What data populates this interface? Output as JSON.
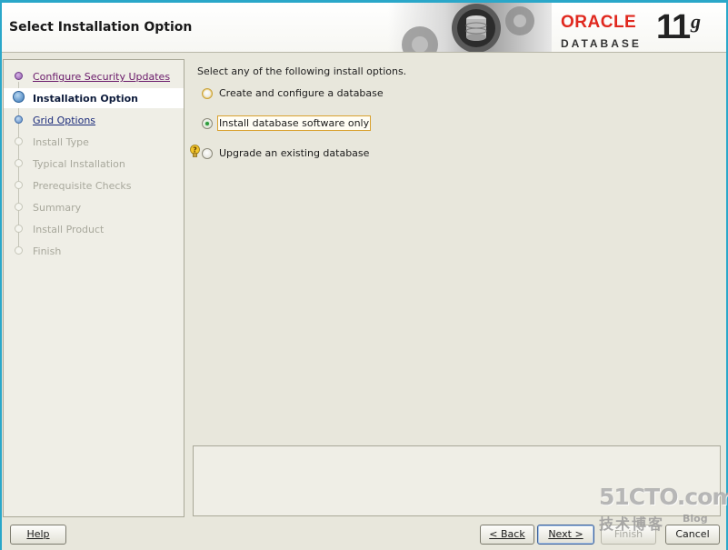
{
  "header": {
    "title": "Select Installation Option",
    "brand": {
      "oracle": "ORACLE",
      "database": "DATABASE",
      "version": "11",
      "version_suffix": "g",
      "accent": "#e0281e"
    }
  },
  "steps": [
    {
      "label": "Configure Security Updates",
      "state": "done"
    },
    {
      "label": "Installation Option",
      "state": "active"
    },
    {
      "label": "Grid Options",
      "state": "link"
    },
    {
      "label": "Install Type",
      "state": "disabled"
    },
    {
      "label": "Typical Installation",
      "state": "disabled"
    },
    {
      "label": "Prerequisite Checks",
      "state": "disabled"
    },
    {
      "label": "Summary",
      "state": "disabled"
    },
    {
      "label": "Install Product",
      "state": "disabled"
    },
    {
      "label": "Finish",
      "state": "disabled"
    }
  ],
  "content": {
    "intro": "Select any of the following install options.",
    "options": [
      {
        "label": "Create and configure a database",
        "checked": false
      },
      {
        "label": "Install database software only",
        "checked": true
      },
      {
        "label": "Upgrade an existing database",
        "checked": false,
        "hint_icon": "lightbulb-icon"
      }
    ]
  },
  "buttons": {
    "help": "Help",
    "back": "< Back",
    "next": "Next >",
    "finish": "Finish",
    "cancel": "Cancel"
  },
  "watermark": {
    "site": "51CTO.com",
    "cn": "技术博客",
    "blog": "Blog"
  }
}
